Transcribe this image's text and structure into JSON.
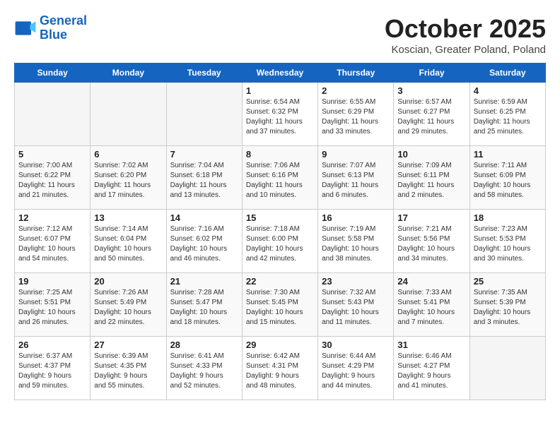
{
  "header": {
    "logo_line1": "General",
    "logo_line2": "Blue",
    "month": "October 2025",
    "location": "Koscian, Greater Poland, Poland"
  },
  "days_of_week": [
    "Sunday",
    "Monday",
    "Tuesday",
    "Wednesday",
    "Thursday",
    "Friday",
    "Saturday"
  ],
  "weeks": [
    [
      {
        "day": "",
        "info": ""
      },
      {
        "day": "",
        "info": ""
      },
      {
        "day": "",
        "info": ""
      },
      {
        "day": "1",
        "info": "Sunrise: 6:54 AM\nSunset: 6:32 PM\nDaylight: 11 hours\nand 37 minutes."
      },
      {
        "day": "2",
        "info": "Sunrise: 6:55 AM\nSunset: 6:29 PM\nDaylight: 11 hours\nand 33 minutes."
      },
      {
        "day": "3",
        "info": "Sunrise: 6:57 AM\nSunset: 6:27 PM\nDaylight: 11 hours\nand 29 minutes."
      },
      {
        "day": "4",
        "info": "Sunrise: 6:59 AM\nSunset: 6:25 PM\nDaylight: 11 hours\nand 25 minutes."
      }
    ],
    [
      {
        "day": "5",
        "info": "Sunrise: 7:00 AM\nSunset: 6:22 PM\nDaylight: 11 hours\nand 21 minutes."
      },
      {
        "day": "6",
        "info": "Sunrise: 7:02 AM\nSunset: 6:20 PM\nDaylight: 11 hours\nand 17 minutes."
      },
      {
        "day": "7",
        "info": "Sunrise: 7:04 AM\nSunset: 6:18 PM\nDaylight: 11 hours\nand 13 minutes."
      },
      {
        "day": "8",
        "info": "Sunrise: 7:06 AM\nSunset: 6:16 PM\nDaylight: 11 hours\nand 10 minutes."
      },
      {
        "day": "9",
        "info": "Sunrise: 7:07 AM\nSunset: 6:13 PM\nDaylight: 11 hours\nand 6 minutes."
      },
      {
        "day": "10",
        "info": "Sunrise: 7:09 AM\nSunset: 6:11 PM\nDaylight: 11 hours\nand 2 minutes."
      },
      {
        "day": "11",
        "info": "Sunrise: 7:11 AM\nSunset: 6:09 PM\nDaylight: 10 hours\nand 58 minutes."
      }
    ],
    [
      {
        "day": "12",
        "info": "Sunrise: 7:12 AM\nSunset: 6:07 PM\nDaylight: 10 hours\nand 54 minutes."
      },
      {
        "day": "13",
        "info": "Sunrise: 7:14 AM\nSunset: 6:04 PM\nDaylight: 10 hours\nand 50 minutes."
      },
      {
        "day": "14",
        "info": "Sunrise: 7:16 AM\nSunset: 6:02 PM\nDaylight: 10 hours\nand 46 minutes."
      },
      {
        "day": "15",
        "info": "Sunrise: 7:18 AM\nSunset: 6:00 PM\nDaylight: 10 hours\nand 42 minutes."
      },
      {
        "day": "16",
        "info": "Sunrise: 7:19 AM\nSunset: 5:58 PM\nDaylight: 10 hours\nand 38 minutes."
      },
      {
        "day": "17",
        "info": "Sunrise: 7:21 AM\nSunset: 5:56 PM\nDaylight: 10 hours\nand 34 minutes."
      },
      {
        "day": "18",
        "info": "Sunrise: 7:23 AM\nSunset: 5:53 PM\nDaylight: 10 hours\nand 30 minutes."
      }
    ],
    [
      {
        "day": "19",
        "info": "Sunrise: 7:25 AM\nSunset: 5:51 PM\nDaylight: 10 hours\nand 26 minutes."
      },
      {
        "day": "20",
        "info": "Sunrise: 7:26 AM\nSunset: 5:49 PM\nDaylight: 10 hours\nand 22 minutes."
      },
      {
        "day": "21",
        "info": "Sunrise: 7:28 AM\nSunset: 5:47 PM\nDaylight: 10 hours\nand 18 minutes."
      },
      {
        "day": "22",
        "info": "Sunrise: 7:30 AM\nSunset: 5:45 PM\nDaylight: 10 hours\nand 15 minutes."
      },
      {
        "day": "23",
        "info": "Sunrise: 7:32 AM\nSunset: 5:43 PM\nDaylight: 10 hours\nand 11 minutes."
      },
      {
        "day": "24",
        "info": "Sunrise: 7:33 AM\nSunset: 5:41 PM\nDaylight: 10 hours\nand 7 minutes."
      },
      {
        "day": "25",
        "info": "Sunrise: 7:35 AM\nSunset: 5:39 PM\nDaylight: 10 hours\nand 3 minutes."
      }
    ],
    [
      {
        "day": "26",
        "info": "Sunrise: 6:37 AM\nSunset: 4:37 PM\nDaylight: 9 hours\nand 59 minutes."
      },
      {
        "day": "27",
        "info": "Sunrise: 6:39 AM\nSunset: 4:35 PM\nDaylight: 9 hours\nand 55 minutes."
      },
      {
        "day": "28",
        "info": "Sunrise: 6:41 AM\nSunset: 4:33 PM\nDaylight: 9 hours\nand 52 minutes."
      },
      {
        "day": "29",
        "info": "Sunrise: 6:42 AM\nSunset: 4:31 PM\nDaylight: 9 hours\nand 48 minutes."
      },
      {
        "day": "30",
        "info": "Sunrise: 6:44 AM\nSunset: 4:29 PM\nDaylight: 9 hours\nand 44 minutes."
      },
      {
        "day": "31",
        "info": "Sunrise: 6:46 AM\nSunset: 4:27 PM\nDaylight: 9 hours\nand 41 minutes."
      },
      {
        "day": "",
        "info": ""
      }
    ]
  ]
}
